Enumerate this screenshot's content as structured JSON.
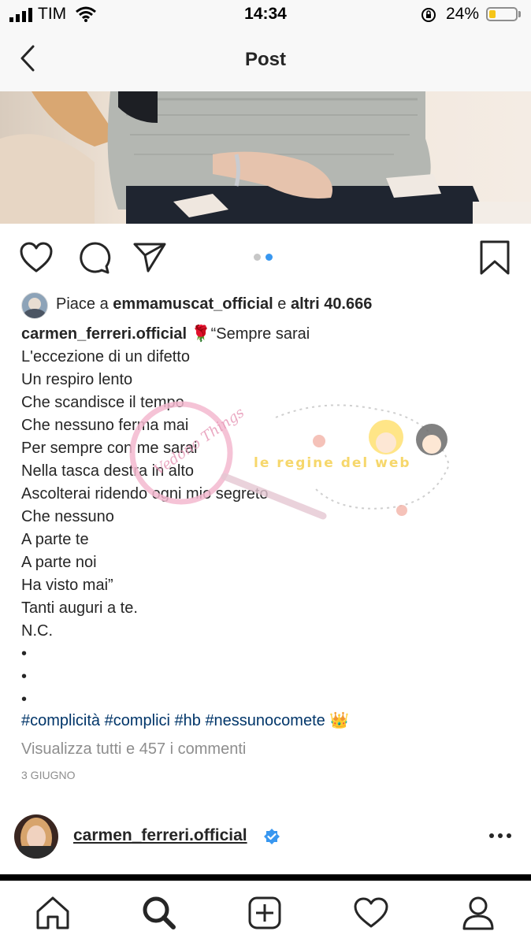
{
  "status_bar": {
    "carrier": "TIM",
    "time": "14:34",
    "battery_percent": "24%",
    "battery_level": 0.24,
    "battery_color": "#f5c518"
  },
  "nav": {
    "title": "Post"
  },
  "post": {
    "carousel_page": 2,
    "carousel_total": 2,
    "likes": {
      "prefix": "Piace a",
      "user": "emmamuscat_official",
      "conjunction": "e",
      "others": "altri 40.666"
    },
    "caption_author": "carmen_ferreri.official",
    "caption_emoji": "🌹",
    "caption_first": "“Sempre sarai",
    "caption_lines": [
      "L'eccezione di un difetto",
      "Un respiro lento",
      "Che scandisce il tempo",
      "Che nessuno ferma mai",
      "Per sempre con me sarai",
      "Nella tasca destra in alto",
      "Ascolterai ridendo ogni mio segreto",
      "Che nessuno",
      "A parte te",
      "A parte noi",
      "Ha visto mai”",
      "Tanti auguri a te.",
      "N.C.",
      "•",
      "•",
      "•"
    ],
    "hashtags": "#complicità #complici #hb #nessunocomete",
    "hashtag_emoji": "👑",
    "view_comments": "Visualizza tutti e 457 i commenti",
    "date": "3 GIUGNO"
  },
  "next_post": {
    "username": "carmen_ferreri.official",
    "verified": true
  },
  "watermark": {
    "text": "le regine del web",
    "script_text": "Vedono Things"
  },
  "tabbar": {
    "icons": [
      "home-icon",
      "search-icon",
      "add-post-icon",
      "activity-heart-icon",
      "profile-icon"
    ],
    "active": "search-icon"
  },
  "colors": {
    "text": "#262626",
    "muted": "#8e8e8e",
    "hashtag": "#003569",
    "carousel_active": "#3897f0",
    "verified": "#3897f0"
  }
}
